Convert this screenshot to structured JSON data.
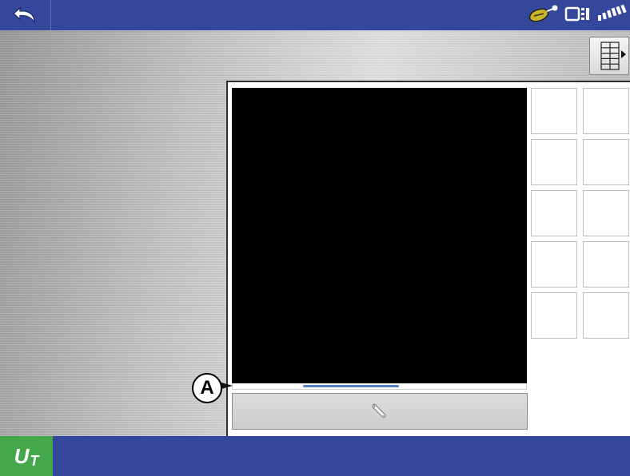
{
  "colors": {
    "topbar": "#35479a",
    "bottombar": "#35479a",
    "ut_green": "#43a84b",
    "video_bg": "#000000",
    "scroll_thumb": "#5b7fc4"
  },
  "topbar": {
    "back_icon": "back-arrow-icon",
    "status_icons": [
      "satellite-dish-icon",
      "display-terminal-icon",
      "signal-strength-icon"
    ]
  },
  "layout_button": {
    "icon": "grid-layout-icon"
  },
  "camera": {
    "callout_label": "A",
    "scroll_position": 0.24,
    "settings_icon": "wrench-icon"
  },
  "tiles": {
    "rows": 5,
    "cols": 2
  },
  "bottombar": {
    "ut_label_u": "U",
    "ut_label_t": "T"
  }
}
